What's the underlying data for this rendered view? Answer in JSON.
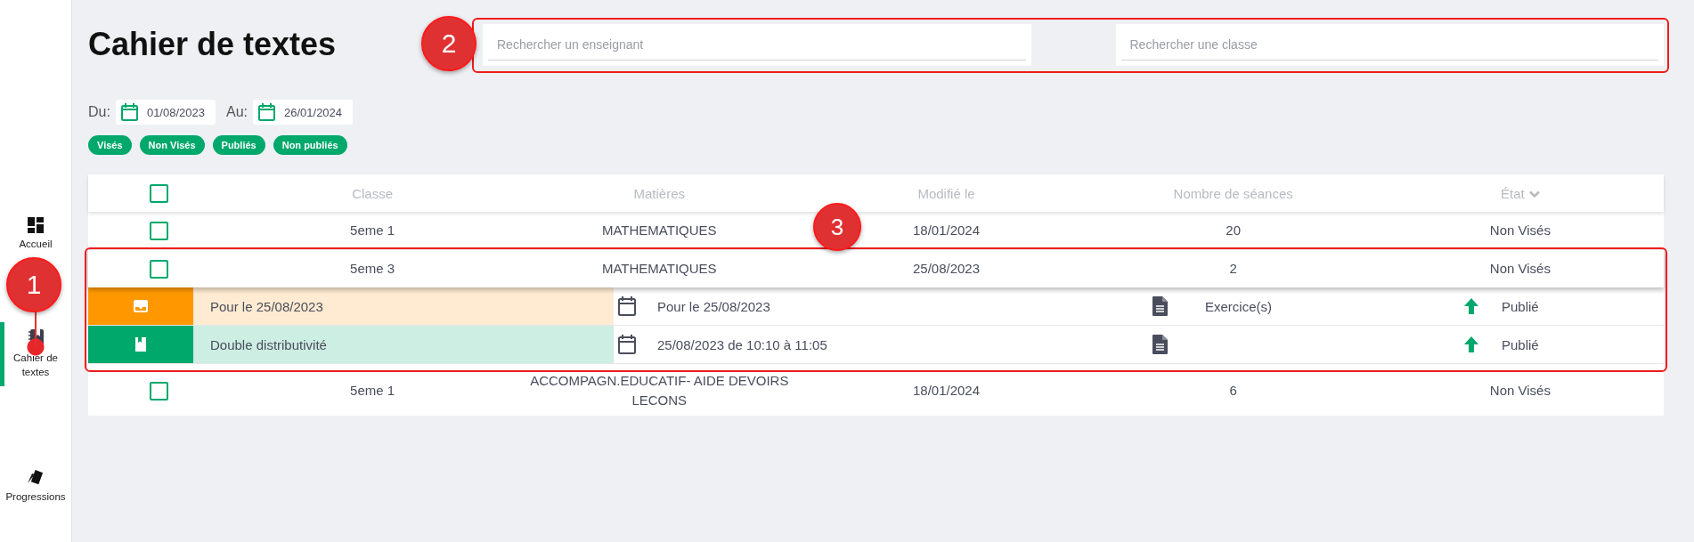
{
  "sidebar": {
    "items": [
      {
        "label": "Accueil",
        "selected": false
      },
      {
        "label": "Cahier de textes",
        "selected": true
      },
      {
        "label": "Progressions",
        "selected": false
      }
    ]
  },
  "title": "Cahier de textes",
  "search": [
    {
      "placeholder": "Rechercher un enseignant"
    },
    {
      "placeholder": "Rechercher une classe"
    }
  ],
  "dates": [
    {
      "label": "Du:",
      "value": "01/08/2023"
    },
    {
      "label": "Au:",
      "value": "26/01/2024"
    }
  ],
  "filters": [
    "Visés",
    "Non Visés",
    "Publiés",
    "Non publiés"
  ],
  "table": {
    "header_checked": false,
    "columns": [
      "Classe",
      "Matières",
      "Modifié le",
      "Nombre de séances",
      "État"
    ],
    "rows": [
      {
        "checked": false,
        "cells": [
          "5eme 1",
          "MATHEMATIQUES",
          "18/01/2024",
          "20",
          "Non Visés"
        ]
      },
      {
        "checked": false,
        "cells": [
          "5eme 3",
          "MATHEMATIQUES",
          "25/08/2023",
          "2",
          "Non Visés"
        ],
        "children": [
          {
            "kind": "homework",
            "title": "Pour le 25/08/2023",
            "date": "Pour le 25/08/2023",
            "type": "Exercice(s)",
            "status": "Publié"
          },
          {
            "kind": "lesson",
            "title": "Double distributivité",
            "date": "25/08/2023 de 10:10 à 11:05",
            "status": "Publié"
          }
        ]
      },
      {
        "checked": false,
        "cells": [
          "5eme 1",
          "ACCOMPAGN.EDUCATIF- AIDE DEVOIRS LECONS",
          "18/01/2024",
          "6",
          "Non Visés"
        ]
      }
    ]
  },
  "annotations": [
    "1",
    "2",
    "3"
  ]
}
